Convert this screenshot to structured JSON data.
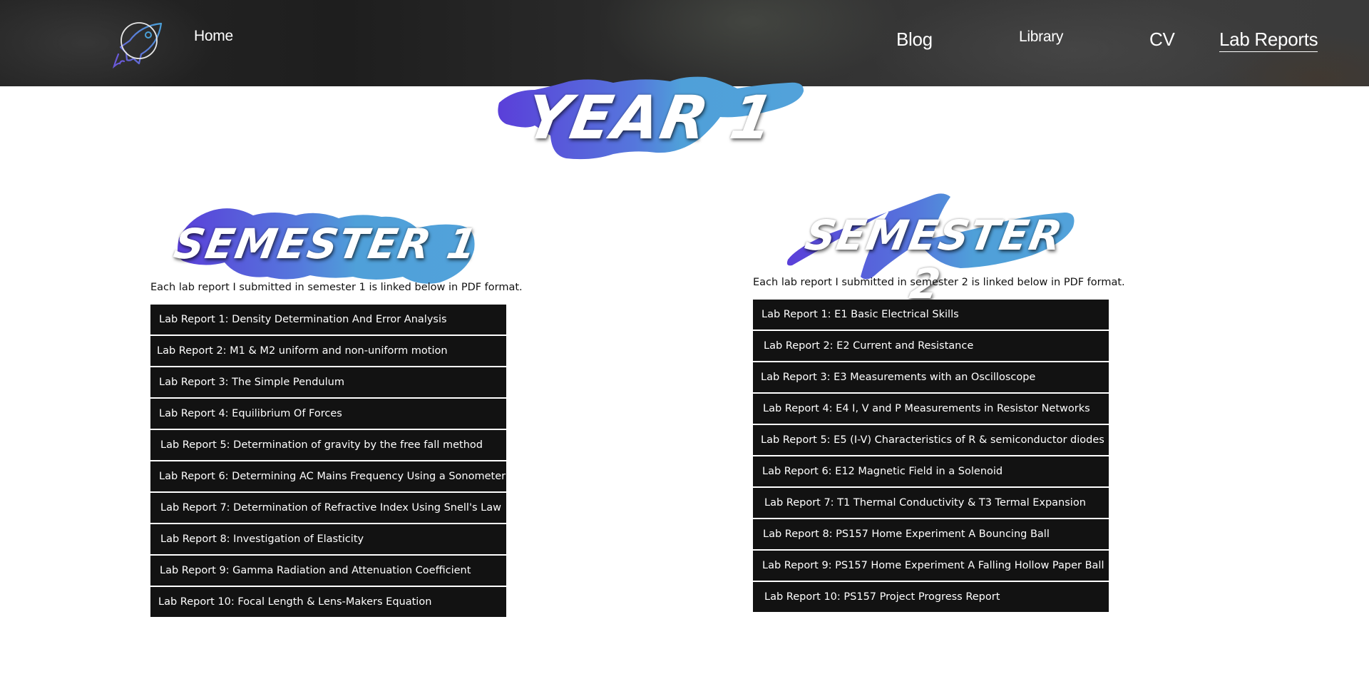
{
  "header": {
    "logo_icon": "rocket-icon",
    "nav": {
      "home": "Home",
      "blog": "Blog",
      "library": "Library",
      "cv": "CV",
      "lab_reports": "Lab Reports"
    },
    "active_nav": "Lab Reports"
  },
  "year_title": "YEAR 1",
  "colors": {
    "brush_start": "#5a3fd9",
    "brush_end": "#4fa3d9",
    "list_item_bg": "#121212",
    "list_item_text": "#ffffff"
  },
  "semester1": {
    "title": "SEMESTER 1",
    "intro": "Each lab report I submitted in semester 1 is linked below in PDF format.",
    "reports": [
      "Lab Report 1: Density Determination And Error Analysis",
      "Lab Report 2: M1 & M2 uniform and non-uniform motion",
      "Lab Report 3: The Simple Pendulum",
      "Lab Report 4: Equilibrium Of Forces",
      "Lab Report 5: Determination of gravity by the free fall method",
      "Lab Report 6: Determining AC Mains Frequency Using a Sonometer",
      "Lab Report 7: Determination of Refractive Index Using Snell's Law",
      "Lab Report 8: Investigation of Elasticity",
      "Lab Report 9: Gamma Radiation and Attenuation Coefficient",
      "Lab Report 10: Focal Length & Lens-Makers Equation"
    ]
  },
  "semester2": {
    "title": "SEMESTER 2",
    "intro": "Each lab report I submitted in semester 2 is linked below in PDF format.",
    "reports": [
      "Lab Report 1: E1 Basic Electrical Skills",
      "Lab Report 2: E2 Current and Resistance",
      "Lab Report 3: E3 Measurements with an Oscilloscope",
      "Lab Report 4: E4 I, V and P Measurements in Resistor Networks",
      "Lab Report 5: E5 (I-V) Characteristics of R & semiconductor diodes",
      "Lab Report 6: E12 Magnetic Field in a Solenoid",
      "Lab Report 7: T1 Thermal Conductivity & T3 Termal Expansion",
      "Lab Report 8: PS157 Home Experiment A Bouncing Ball",
      "Lab Report 9: PS157 Home Experiment A Falling Hollow Paper Ball",
      "Lab Report 10: PS157 Project Progress Report"
    ]
  }
}
